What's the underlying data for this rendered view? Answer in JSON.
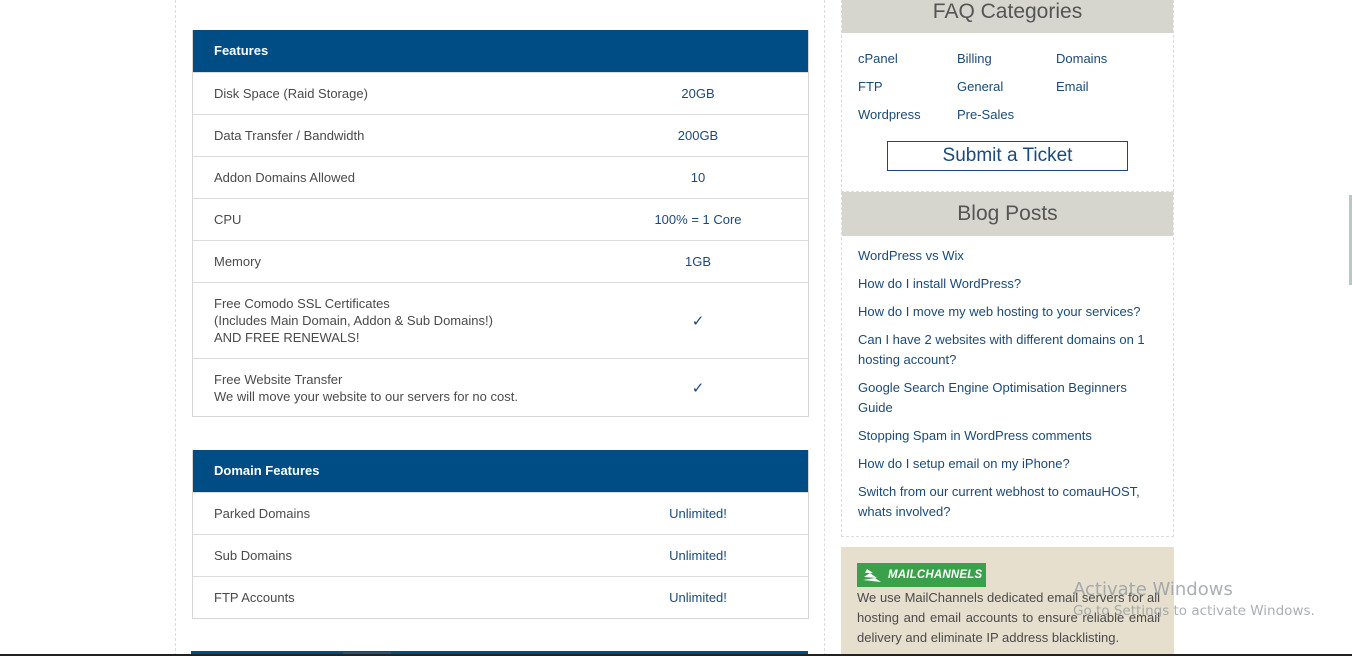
{
  "features_table": {
    "title": "Features",
    "rows": [
      {
        "label": "Disk Space (Raid Storage)",
        "value": "20GB"
      },
      {
        "label": "Data Transfer / Bandwidth",
        "value": "200GB"
      },
      {
        "label": "Addon Domains Allowed",
        "value": "10"
      },
      {
        "label": "CPU",
        "value": "100% = 1 Core"
      },
      {
        "label": "Memory",
        "value": "1GB"
      },
      {
        "label": "Free Comodo SSL Certificates\n(Includes Main Domain, Addon & Sub Domains!)\nAND FREE RENEWALS!",
        "value": "✓",
        "icon": "checkmark-icon"
      },
      {
        "label": "Free Website Transfer\nWe will move your website to our servers for no cost.",
        "value": "✓",
        "icon": "checkmark-icon"
      }
    ]
  },
  "domain_features_table": {
    "title": "Domain Features",
    "rows": [
      {
        "label": "Parked Domains",
        "value": "Unlimited!"
      },
      {
        "label": "Sub Domains",
        "value": "Unlimited!"
      },
      {
        "label": "FTP Accounts",
        "value": "Unlimited!"
      }
    ]
  },
  "sidebar": {
    "faq": {
      "title": "FAQ Categories",
      "categories": [
        "cPanel",
        "Billing",
        "Domains",
        "FTP",
        "General",
        "Email",
        "Wordpress",
        "Pre-Sales"
      ],
      "ticket_button": "Submit a Ticket"
    },
    "blog": {
      "title": "Blog Posts",
      "posts": [
        "WordPress vs Wix",
        "How do I install WordPress?",
        "How do I move my web hosting to your services?",
        "Can I have 2 websites with different domains on 1 hosting account?",
        "Google Search Engine Optimisation Beginners Guide",
        "Stopping Spam in WordPress comments",
        "How do I setup email on my iPhone?",
        "Switch from our current webhost to comauHOST, whats involved?"
      ]
    },
    "mailchannels": {
      "logo_text": "MAILCHANNELS",
      "description": "We use MailChannels dedicated email servers for all hosting and email accounts to ensure reliable email delivery and eliminate IP address blacklisting."
    }
  },
  "os_overlay": {
    "line1": "Activate Windows",
    "line2": "Go to Settings to activate Windows."
  },
  "colors": {
    "table_header": "#004c84",
    "link": "#1b4a78",
    "widget_header": "#d6d5ce",
    "mailchannels_bg": "#e6dfce",
    "mailchannels_green": "#3aa04a"
  }
}
